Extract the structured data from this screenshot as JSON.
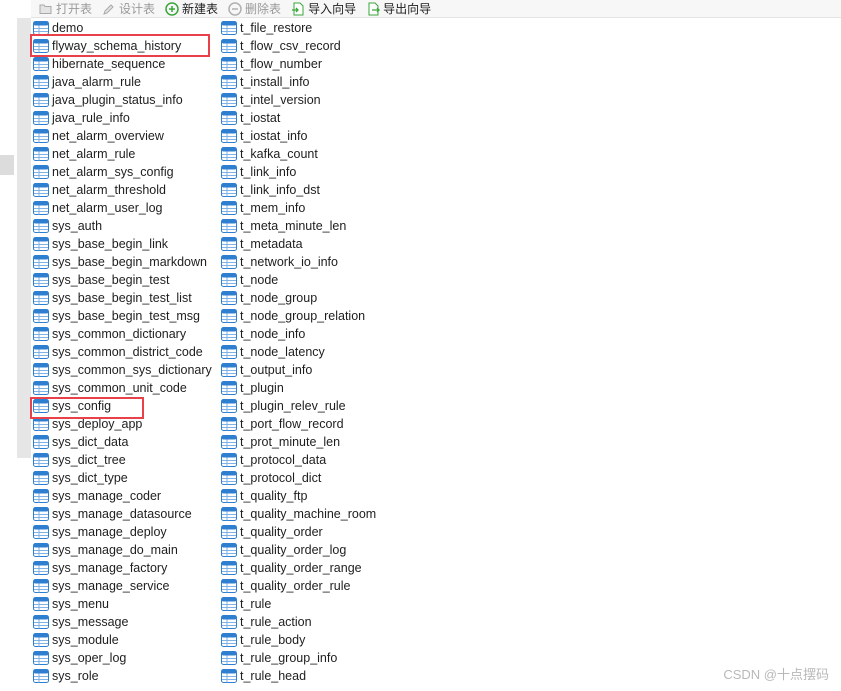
{
  "toolbar": {
    "open_table": "打开表",
    "design_table": "设计表",
    "new_table": "新建表",
    "delete_table": "删除表",
    "import_wizard": "导入向导",
    "export_wizard": "导出向导"
  },
  "tables_col1": [
    "demo",
    "flyway_schema_history",
    "hibernate_sequence",
    "java_alarm_rule",
    "java_plugin_status_info",
    "java_rule_info",
    "net_alarm_overview",
    "net_alarm_rule",
    "net_alarm_sys_config",
    "net_alarm_threshold",
    "net_alarm_user_log",
    "sys_auth",
    "sys_base_begin_link",
    "sys_base_begin_markdown",
    "sys_base_begin_test",
    "sys_base_begin_test_list",
    "sys_base_begin_test_msg",
    "sys_common_dictionary",
    "sys_common_district_code",
    "sys_common_sys_dictionary",
    "sys_common_unit_code",
    "sys_config",
    "sys_deploy_app",
    "sys_dict_data",
    "sys_dict_tree",
    "sys_dict_type",
    "sys_manage_coder",
    "sys_manage_datasource",
    "sys_manage_deploy",
    "sys_manage_do_main",
    "sys_manage_factory",
    "sys_manage_service",
    "sys_menu",
    "sys_message",
    "sys_module",
    "sys_oper_log",
    "sys_role"
  ],
  "tables_col2": [
    "t_file_restore",
    "t_flow_csv_record",
    "t_flow_number",
    "t_install_info",
    "t_intel_version",
    "t_iostat",
    "t_iostat_info",
    "t_kafka_count",
    "t_link_info",
    "t_link_info_dst",
    "t_mem_info",
    "t_meta_minute_len",
    "t_metadata",
    "t_network_io_info",
    "t_node",
    "t_node_group",
    "t_node_group_relation",
    "t_node_info",
    "t_node_latency",
    "t_output_info",
    "t_plugin",
    "t_plugin_relev_rule",
    "t_port_flow_record",
    "t_prot_minute_len",
    "t_protocol_data",
    "t_protocol_dict",
    "t_quality_ftp",
    "t_quality_machine_room",
    "t_quality_order",
    "t_quality_order_log",
    "t_quality_order_range",
    "t_quality_order_rule",
    "t_rule",
    "t_rule_action",
    "t_rule_body",
    "t_rule_group_info",
    "t_rule_head"
  ],
  "highlighted": [
    "flyway_schema_history",
    "sys_config"
  ],
  "watermark": "CSDN @十点摆码",
  "colors": {
    "highlight": "#e8414a",
    "icon_blue": "#2f7fd1"
  }
}
